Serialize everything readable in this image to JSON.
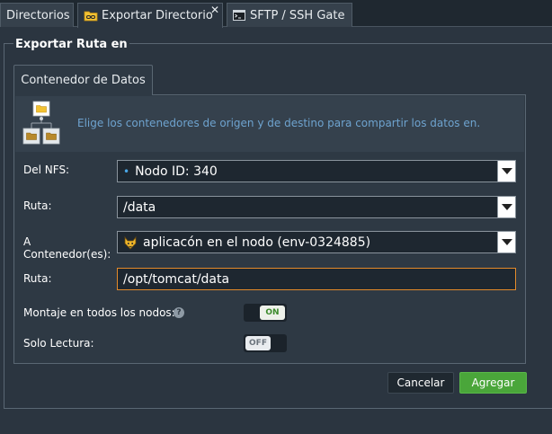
{
  "tabs": [
    {
      "label": "Directorios",
      "icon": "none"
    },
    {
      "label": "Exportar Directorio",
      "icon": "folder-link-icon",
      "active": true,
      "close": "✕"
    },
    {
      "label": "SFTP / SSH Gate",
      "icon": "terminal-icon"
    }
  ],
  "section": {
    "legend": "Exportar Ruta en"
  },
  "subtab": {
    "label": "Contenedor de Datos"
  },
  "info": {
    "text": "Elige los contenedores de origen y de destino para compartir los datos en."
  },
  "form": {
    "nfs": {
      "label": "Del NFS:",
      "value": "Nodo ID: 340",
      "bullet": "•"
    },
    "ruta1": {
      "label": "Ruta:",
      "value": "/data"
    },
    "container": {
      "label_line1": "A",
      "label_line2": "Contenedor(es):",
      "value": "aplicacón en el nodo (env-0324885)"
    },
    "ruta2": {
      "label": "Ruta:",
      "value": "/opt/tomcat/data"
    },
    "mount_all": {
      "label": "Montaje en todos los nodos:",
      "help": "?",
      "state": "ON"
    },
    "read_only": {
      "label": "Solo Lectura:",
      "state": "OFF"
    }
  },
  "buttons": {
    "cancel": "Cancelar",
    "add": "Agregar"
  },
  "colors": {
    "accent_green": "#4aa63a",
    "focus_orange": "#e48a2a",
    "info_blue": "#6ea3cf",
    "background": "#2b3540"
  }
}
